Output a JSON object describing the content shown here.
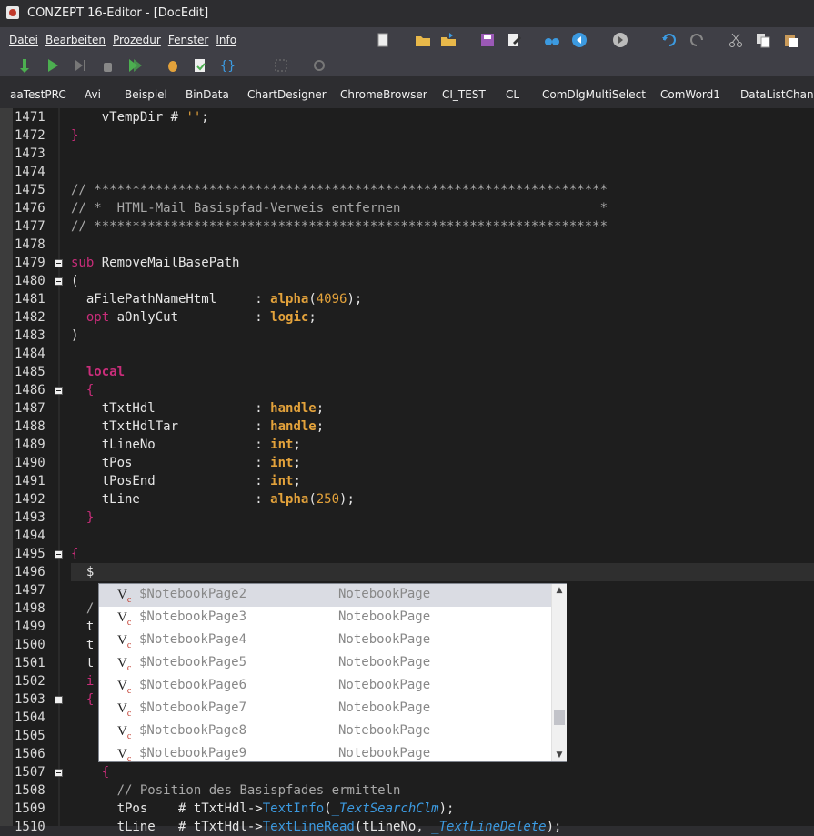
{
  "window": {
    "title": "CONZEPT 16-Editor - [DocEdit]"
  },
  "menu": [
    "Datei",
    "Bearbeiten",
    "Prozedur",
    "Fenster",
    "Info"
  ],
  "toolbar": {
    "row1": [
      "new-document-icon",
      "open-folder-icon",
      "open-recent-icon",
      "save-icon",
      "edit-icon",
      "binoculars-icon",
      "back-arrow-icon",
      "forward-arrow-icon",
      "undo-icon",
      "redo-icon",
      "cut-icon",
      "copy-icon",
      "paste-icon"
    ],
    "row2": [
      "step-icon",
      "run-icon",
      "stop-icon",
      "hand-icon",
      "run-all-icon",
      "debug-bug-icon",
      "check-doc-icon",
      "braces-icon",
      "expand-icon",
      "settings-icon"
    ]
  },
  "tabs": [
    "aaTestPRC",
    "Avi",
    "Beispiel",
    "BinData",
    "ChartDesigner",
    "ChromeBrowser",
    "CI_TEST",
    "CL",
    "ComDlgMultiSelect",
    "ComWord1",
    "DataListChange"
  ],
  "editor": {
    "lines": [
      "1471",
      "1472",
      "1473",
      "1474",
      "1475",
      "1476",
      "1477",
      "1478",
      "1479",
      "1480",
      "1481",
      "1482",
      "1483",
      "1484",
      "1485",
      "1486",
      "1487",
      "1488",
      "1489",
      "1490",
      "1491",
      "1492",
      "1493",
      "1494",
      "1495",
      "1496",
      "1497",
      "1498",
      "1499",
      "1500",
      "1501",
      "1502",
      "1503",
      "1504",
      "1505",
      "1506",
      "1507",
      "1508",
      "1509",
      "1510"
    ]
  },
  "autocomplete": {
    "items": [
      {
        "name": "$NotebookPage2",
        "type": "NotebookPage"
      },
      {
        "name": "$NotebookPage3",
        "type": "NotebookPage"
      },
      {
        "name": "$NotebookPage4",
        "type": "NotebookPage"
      },
      {
        "name": "$NotebookPage5",
        "type": "NotebookPage"
      },
      {
        "name": "$NotebookPage6",
        "type": "NotebookPage"
      },
      {
        "name": "$NotebookPage7",
        "type": "NotebookPage"
      },
      {
        "name": "$NotebookPage8",
        "type": "NotebookPage"
      },
      {
        "name": "$NotebookPage9",
        "type": "NotebookPage"
      }
    ]
  }
}
